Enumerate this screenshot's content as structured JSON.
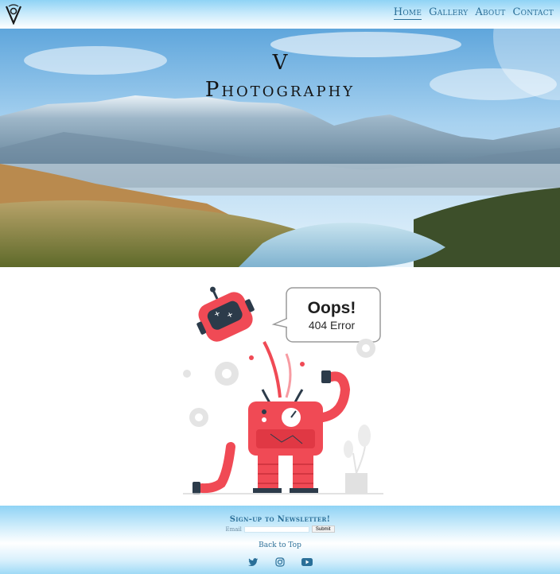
{
  "header": {
    "logo_icon": "v-logo-icon",
    "nav": [
      {
        "label": "Home",
        "active": true
      },
      {
        "label": "Gallery",
        "active": false
      },
      {
        "label": "About",
        "active": false
      },
      {
        "label": "Contact",
        "active": false
      }
    ]
  },
  "hero": {
    "title_line1": "V",
    "title_line2": "Photography"
  },
  "illustration": {
    "bubble_title": "Oops!",
    "bubble_subtitle": "404 Error",
    "accent_color": "#f04a55"
  },
  "footer": {
    "newsletter_title": "Sign-up to Newsletter!",
    "email_label": "Email",
    "email_placeholder": "",
    "submit_label": "Submit",
    "back_to_top": "Back to Top",
    "socials": [
      "twitter-icon",
      "instagram-icon",
      "youtube-icon"
    ]
  },
  "colors": {
    "link": "#2a6f98",
    "header_gradient_top": "#8fd3f5"
  }
}
